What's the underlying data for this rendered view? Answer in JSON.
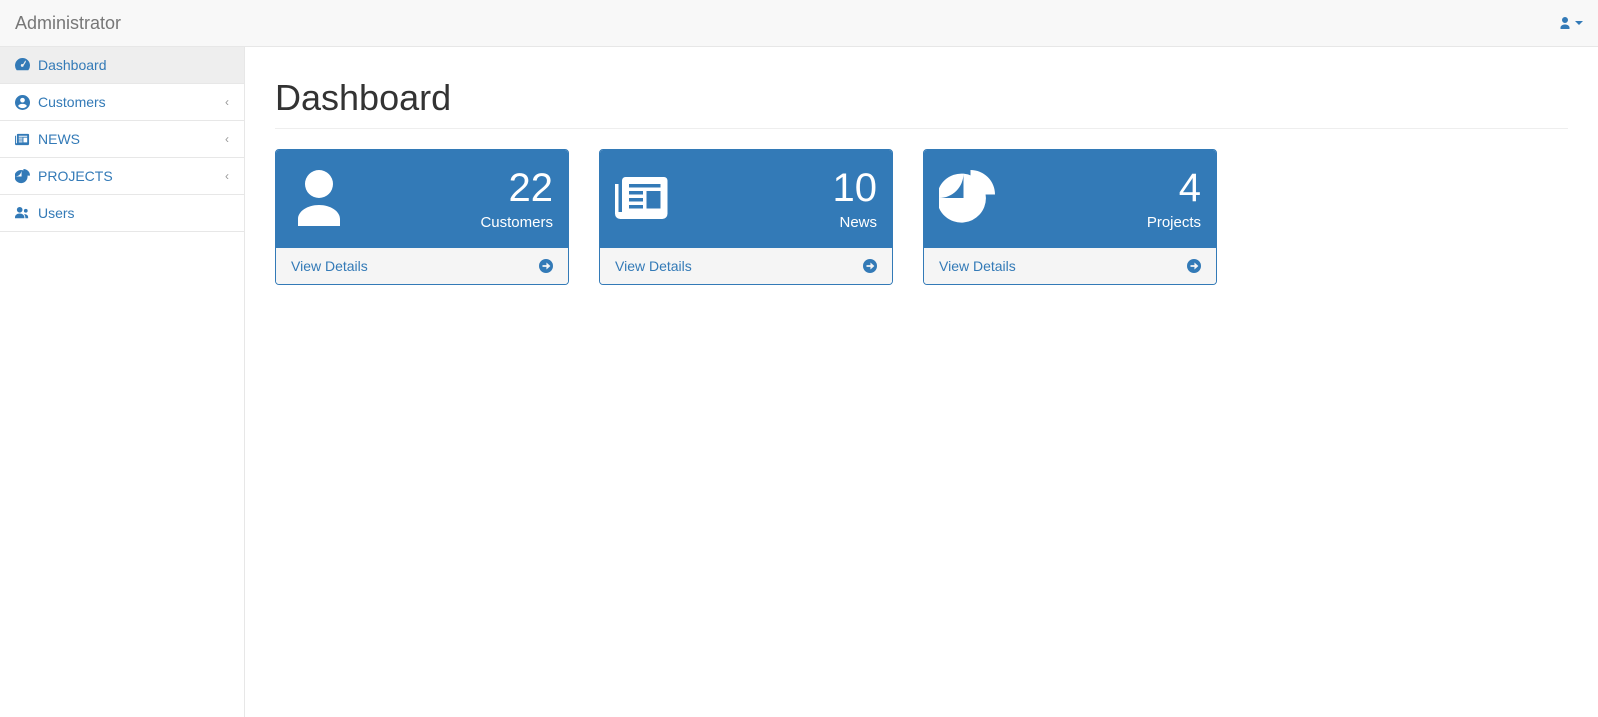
{
  "header": {
    "brand": "Administrator"
  },
  "sidebar": {
    "items": [
      {
        "label": "Dashboard",
        "expandable": false,
        "active": true,
        "icon": "dashboard"
      },
      {
        "label": "Customers",
        "expandable": true,
        "active": false,
        "icon": "user-circle"
      },
      {
        "label": "NEWS",
        "expandable": true,
        "active": false,
        "icon": "newspaper"
      },
      {
        "label": "PROJECTS",
        "expandable": true,
        "active": false,
        "icon": "pie-chart"
      },
      {
        "label": "Users",
        "expandable": false,
        "active": false,
        "icon": "users"
      }
    ]
  },
  "main": {
    "title": "Dashboard",
    "cards": [
      {
        "value": "22",
        "label": "Customers",
        "link_label": "View Details",
        "icon": "user"
      },
      {
        "value": "10",
        "label": "News",
        "link_label": "View Details",
        "icon": "newspaper"
      },
      {
        "value": "4",
        "label": "Projects",
        "link_label": "View Details",
        "icon": "pie-chart"
      }
    ]
  }
}
